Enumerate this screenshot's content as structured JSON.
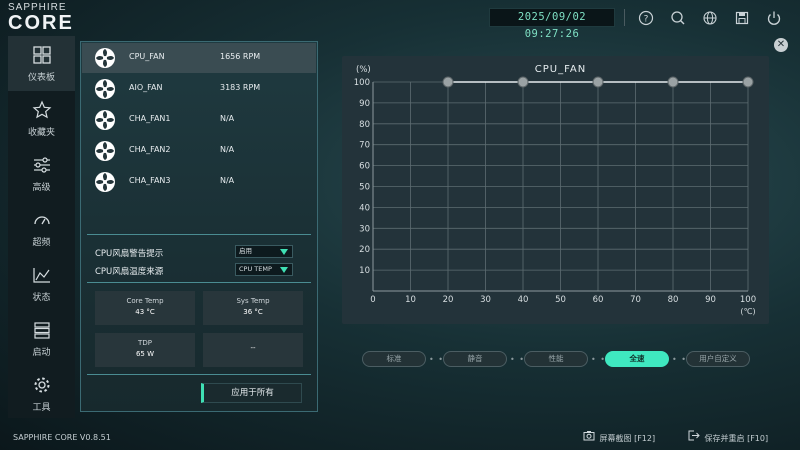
{
  "app": {
    "logo_top": "SAPPHIRE",
    "logo_main": "CORE",
    "datetime": "2025/09/02 09:27:26",
    "version": "SAPPHIRE CORE V0.8.51"
  },
  "top_icons": [
    "help-icon",
    "search-icon",
    "globe-icon",
    "save-icon",
    "power-icon"
  ],
  "sidebar": {
    "items": [
      {
        "label": "仪表板",
        "icon": "dashboard-icon",
        "active": true
      },
      {
        "label": "收藏夹",
        "icon": "star-icon",
        "active": false
      },
      {
        "label": "高级",
        "icon": "sliders-icon",
        "active": false
      },
      {
        "label": "超频",
        "icon": "gauge-icon",
        "active": false
      },
      {
        "label": "状态",
        "icon": "chart-icon",
        "active": false
      },
      {
        "label": "启动",
        "icon": "list-icon",
        "active": false
      },
      {
        "label": "工具",
        "icon": "gear-icon",
        "active": false
      }
    ]
  },
  "fans": [
    {
      "name": "CPU_FAN",
      "value": "1656 RPM",
      "selected": true
    },
    {
      "name": "AIO_FAN",
      "value": "3183 RPM",
      "selected": false
    },
    {
      "name": "CHA_FAN1",
      "value": "N/A",
      "selected": false
    },
    {
      "name": "CHA_FAN2",
      "value": "N/A",
      "selected": false
    },
    {
      "name": "CHA_FAN3",
      "value": "N/A",
      "selected": false
    }
  ],
  "settings": {
    "warning_label": "CPU风扇警告提示",
    "warning_value": "启用",
    "source_label": "CPU风扇温度来源",
    "source_value": "CPU TEMP"
  },
  "cards": [
    {
      "title": "Core Temp",
      "value": "43 °C"
    },
    {
      "title": "Sys Temp",
      "value": "36 °C"
    },
    {
      "title": "TDP",
      "value": "65 W"
    },
    {
      "title": "",
      "value": "--"
    }
  ],
  "apply_label": "应用于所有",
  "presets": [
    {
      "label": "标准",
      "active": false
    },
    {
      "label": "静音",
      "active": false
    },
    {
      "label": "性能",
      "active": false
    },
    {
      "label": "全速",
      "active": true
    },
    {
      "label": "用户自定义",
      "active": false
    }
  ],
  "footer": {
    "screenshot": "屏幕截图 [F12]",
    "save_restart": "保存并重启 [F10]"
  },
  "chart_data": {
    "type": "line",
    "title": "CPU_FAN",
    "ylabel": "(%)",
    "xlabel": "(℃)",
    "x_ticks": [
      0,
      10,
      20,
      30,
      40,
      50,
      60,
      70,
      80,
      90,
      100
    ],
    "y_ticks": [
      0,
      10,
      20,
      30,
      40,
      50,
      60,
      70,
      80,
      90,
      100
    ],
    "xlim": [
      0,
      100
    ],
    "ylim": [
      0,
      100
    ],
    "grid": true,
    "series": [
      {
        "x": [
          20,
          40,
          60,
          80,
          100
        ],
        "y": [
          100,
          100,
          100,
          100,
          100
        ]
      }
    ]
  }
}
